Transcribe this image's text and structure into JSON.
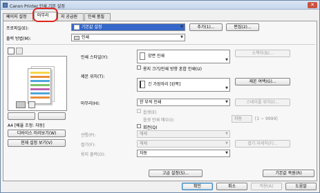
{
  "window": {
    "title": "Canon Printer 인쇄 기본 설정",
    "close_glyph": "✕"
  },
  "tabs": [
    {
      "label": "페이지 설정"
    },
    {
      "label": "마무리"
    },
    {
      "label": "지 공급원"
    },
    {
      "label": "인쇄 품질"
    }
  ],
  "profile": {
    "label": "프로파일(E):",
    "value": "기본값 설정",
    "add_btn": "추가(1)...",
    "edit_btn": "편집(2)..."
  },
  "output": {
    "label": "출력 방법(M):",
    "value": "인쇄"
  },
  "preview": {
    "size_text": "A4 [배율 조정: 자동]",
    "printer_view_btn": "디바이스 미리보기(W)",
    "current_settings_btn": "현재 설정 보기(V)"
  },
  "print_style": {
    "label": "인쇄 스타일(Y):",
    "value": "양면 인쇄",
    "stapled_btn": "소책자(B)...",
    "mixed_label": "용지 크기/인쇄 방향 혼합 인쇄(U)"
  },
  "binding": {
    "label": "제본 위치(T):",
    "value": "긴 가장자리 [왼쪽]",
    "margin_btn": "제본 여백(G)..."
  },
  "finishing": {
    "label": "마무리(H):",
    "value": "한 부씩 인쇄",
    "staple_btn": "스테이플 위치(I)...",
    "offset_label": "옵셋(E)",
    "offset_count_label": "옵셋 인쇄 매수(I):",
    "offset_count_value": "자동",
    "offset_range": "[1 ~ 9999]",
    "rotate_label": "회전(Q)"
  },
  "fold": {
    "label": "접기(F):",
    "value": "해제",
    "detail_btn": "접기 자세히(F)..."
  },
  "punch": {
    "label": "관통(P):",
    "value": "해제"
  },
  "output_tray": {
    "label": "용지 출력(O):",
    "value": "자동"
  },
  "bottom": {
    "advanced_btn": "고급 설정(S)...",
    "restore_btn": "기본값 복원(R)"
  },
  "dialog": {
    "ok": "확인",
    "cancel": "취소",
    "apply": "적용(A)",
    "help": "도움말"
  },
  "colors": {
    "accent": "#3467c9",
    "highlight": "#e2231a"
  }
}
